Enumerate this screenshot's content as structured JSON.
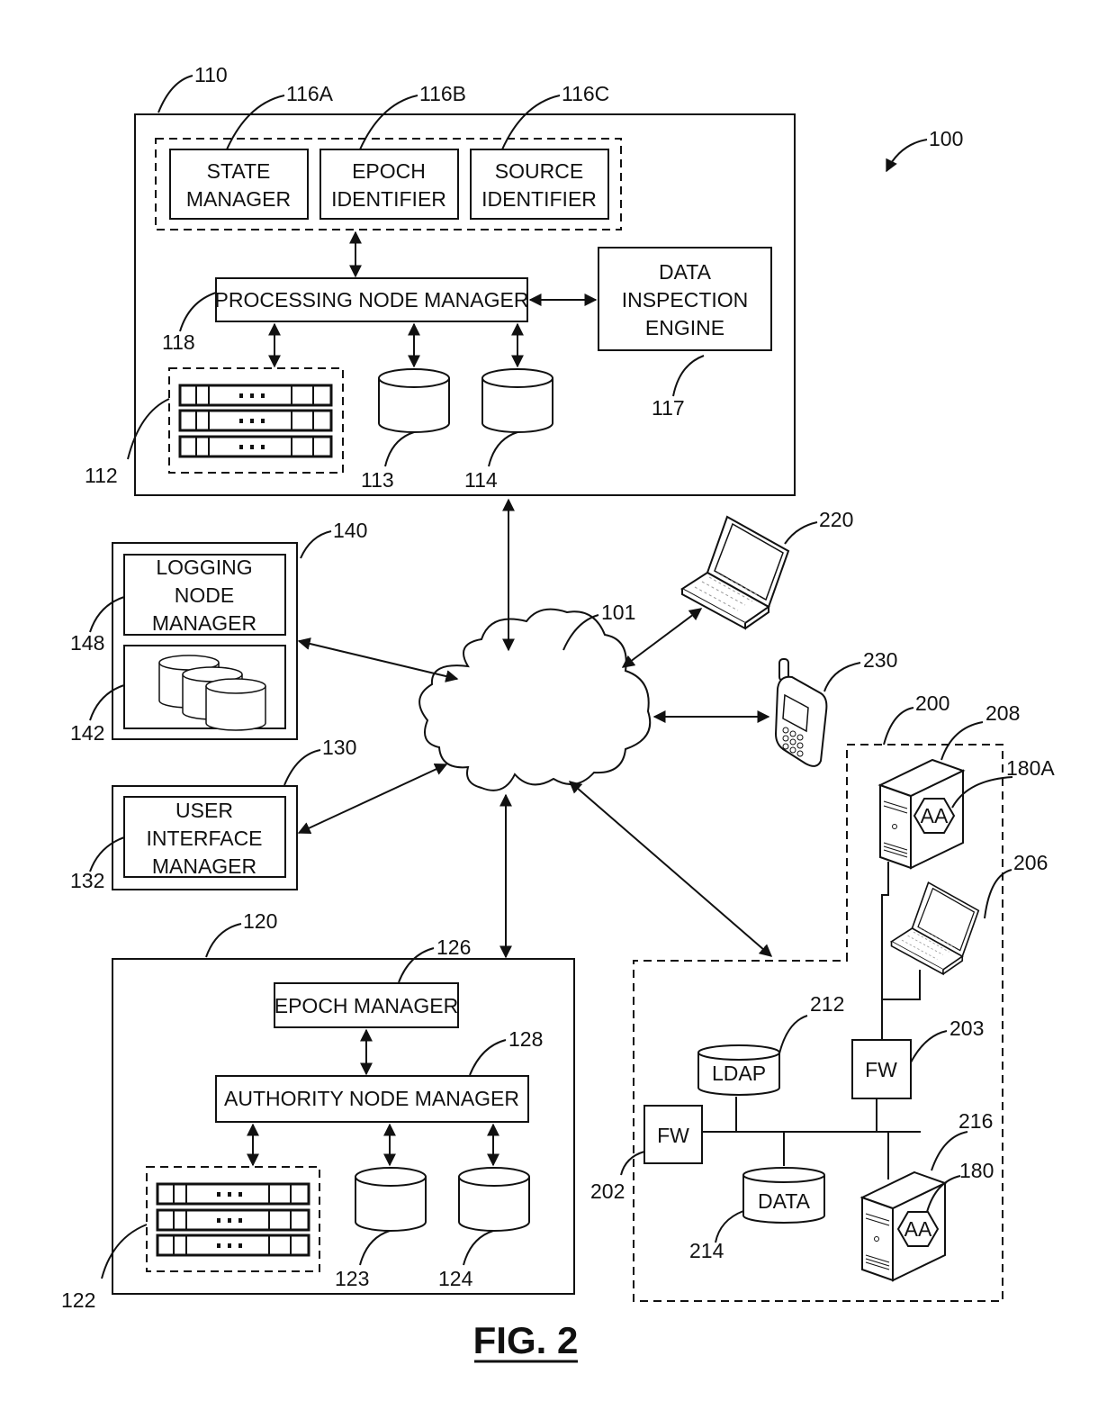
{
  "figure": {
    "title": "FIG. 2",
    "system_ref": "100"
  },
  "network": {
    "ref": "101"
  },
  "processing_node": {
    "ref": "110",
    "state_manager": {
      "ref": "116A",
      "lines": [
        "STATE",
        "MANAGER"
      ]
    },
    "epoch_identifier": {
      "ref": "116B",
      "lines": [
        "EPOCH",
        "IDENTIFIER"
      ]
    },
    "source_identifier": {
      "ref": "116C",
      "lines": [
        "SOURCE",
        "IDENTIFIER"
      ]
    },
    "manager": {
      "ref": "118",
      "label": "PROCESSING NODE MANAGER"
    },
    "inspection_engine": {
      "ref": "117",
      "lines": [
        "DATA",
        "INSPECTION",
        "ENGINE"
      ]
    },
    "servers": {
      "ref": "112"
    },
    "db1": {
      "ref": "113"
    },
    "db2": {
      "ref": "114"
    }
  },
  "logging_node": {
    "ref": "140",
    "manager": {
      "ref": "148",
      "lines": [
        "LOGGING",
        "NODE",
        "MANAGER"
      ]
    },
    "storage": {
      "ref": "142"
    }
  },
  "ui_node": {
    "ref": "130",
    "manager": {
      "ref": "132",
      "lines": [
        "USER",
        "INTERFACE",
        "MANAGER"
      ]
    }
  },
  "authority_node": {
    "ref": "120",
    "epoch_manager": {
      "ref": "126",
      "label": "EPOCH MANAGER"
    },
    "manager": {
      "ref": "128",
      "label": "AUTHORITY NODE MANAGER"
    },
    "servers": {
      "ref": "122"
    },
    "db1": {
      "ref": "123"
    },
    "db2": {
      "ref": "124"
    }
  },
  "devices": {
    "laptop": {
      "ref": "220"
    },
    "phone": {
      "ref": "230"
    }
  },
  "enterprise": {
    "ref": "200",
    "server_top": {
      "ref": "208",
      "agent_ref": "180A",
      "agent_label": "AA"
    },
    "laptop": {
      "ref": "206"
    },
    "fw_top": {
      "ref": "203",
      "label": "FW"
    },
    "fw_left": {
      "ref": "202",
      "label": "FW"
    },
    "ldap": {
      "ref": "212",
      "label": "LDAP"
    },
    "data": {
      "ref": "214",
      "label": "DATA"
    },
    "server_bottom": {
      "ref": "216",
      "agent_ref": "180",
      "agent_label": "AA"
    }
  }
}
